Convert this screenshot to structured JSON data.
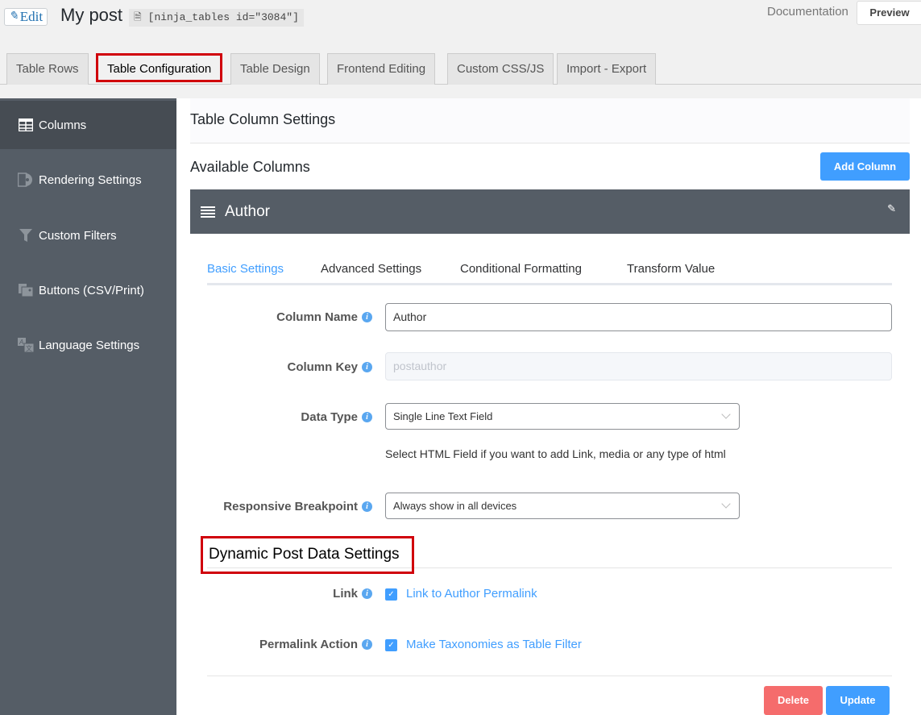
{
  "header": {
    "edit_label": "Edit",
    "post_title": "My post",
    "shortcode": "[ninja_tables id=\"3084\"]",
    "documentation_label": "Documentation",
    "preview_label": "Preview"
  },
  "tabs": [
    {
      "label": "Table Rows",
      "active": false
    },
    {
      "label": "Table Configuration",
      "active": true
    },
    {
      "label": "Table Design",
      "active": false
    },
    {
      "label": "Frontend Editing",
      "active": false
    },
    {
      "label": "Custom CSS/JS",
      "active": false
    },
    {
      "label": "Import - Export",
      "active": false
    }
  ],
  "sidebar": {
    "items": [
      {
        "label": "Columns",
        "icon": "table-icon",
        "active": true
      },
      {
        "label": "Rendering Settings",
        "icon": "rendering-icon",
        "active": false
      },
      {
        "label": "Custom Filters",
        "icon": "filter-icon",
        "active": false
      },
      {
        "label": "Buttons (CSV/Print)",
        "icon": "buttons-icon",
        "active": false
      },
      {
        "label": "Language Settings",
        "icon": "translate-icon",
        "active": false
      }
    ]
  },
  "main": {
    "section_title": "Table Column Settings",
    "available_columns_label": "Available Columns",
    "add_column_label": "Add Column",
    "column_bar_name": "Author",
    "subtabs": [
      {
        "label": "Basic Settings",
        "active": true
      },
      {
        "label": "Advanced Settings",
        "active": false
      },
      {
        "label": "Conditional Formatting",
        "active": false
      },
      {
        "label": "Transform Value",
        "active": false
      }
    ],
    "fields": {
      "column_name": {
        "label": "Column Name",
        "value": "Author"
      },
      "column_key": {
        "label": "Column Key",
        "placeholder": "postauthor"
      },
      "data_type": {
        "label": "Data Type",
        "value": "Single Line Text Field",
        "help": "Select HTML Field if you want to add Link, media or any type of html"
      },
      "responsive_breakpoint": {
        "label": "Responsive Breakpoint",
        "value": "Always show in all devices"
      }
    },
    "dynamic": {
      "title": "Dynamic Post Data Settings",
      "link": {
        "label": "Link",
        "checkbox_label": "Link to Author Permalink",
        "checked": true
      },
      "permalink_action": {
        "label": "Permalink Action",
        "checkbox_label": "Make Taxonomies as Table Filter",
        "checked": true
      }
    },
    "delete_label": "Delete",
    "update_label": "Update"
  },
  "colors": {
    "accent": "#409eff",
    "danger": "#f56c6c",
    "sidebar_bg": "#555d66",
    "highlight_border": "#d0000b"
  }
}
